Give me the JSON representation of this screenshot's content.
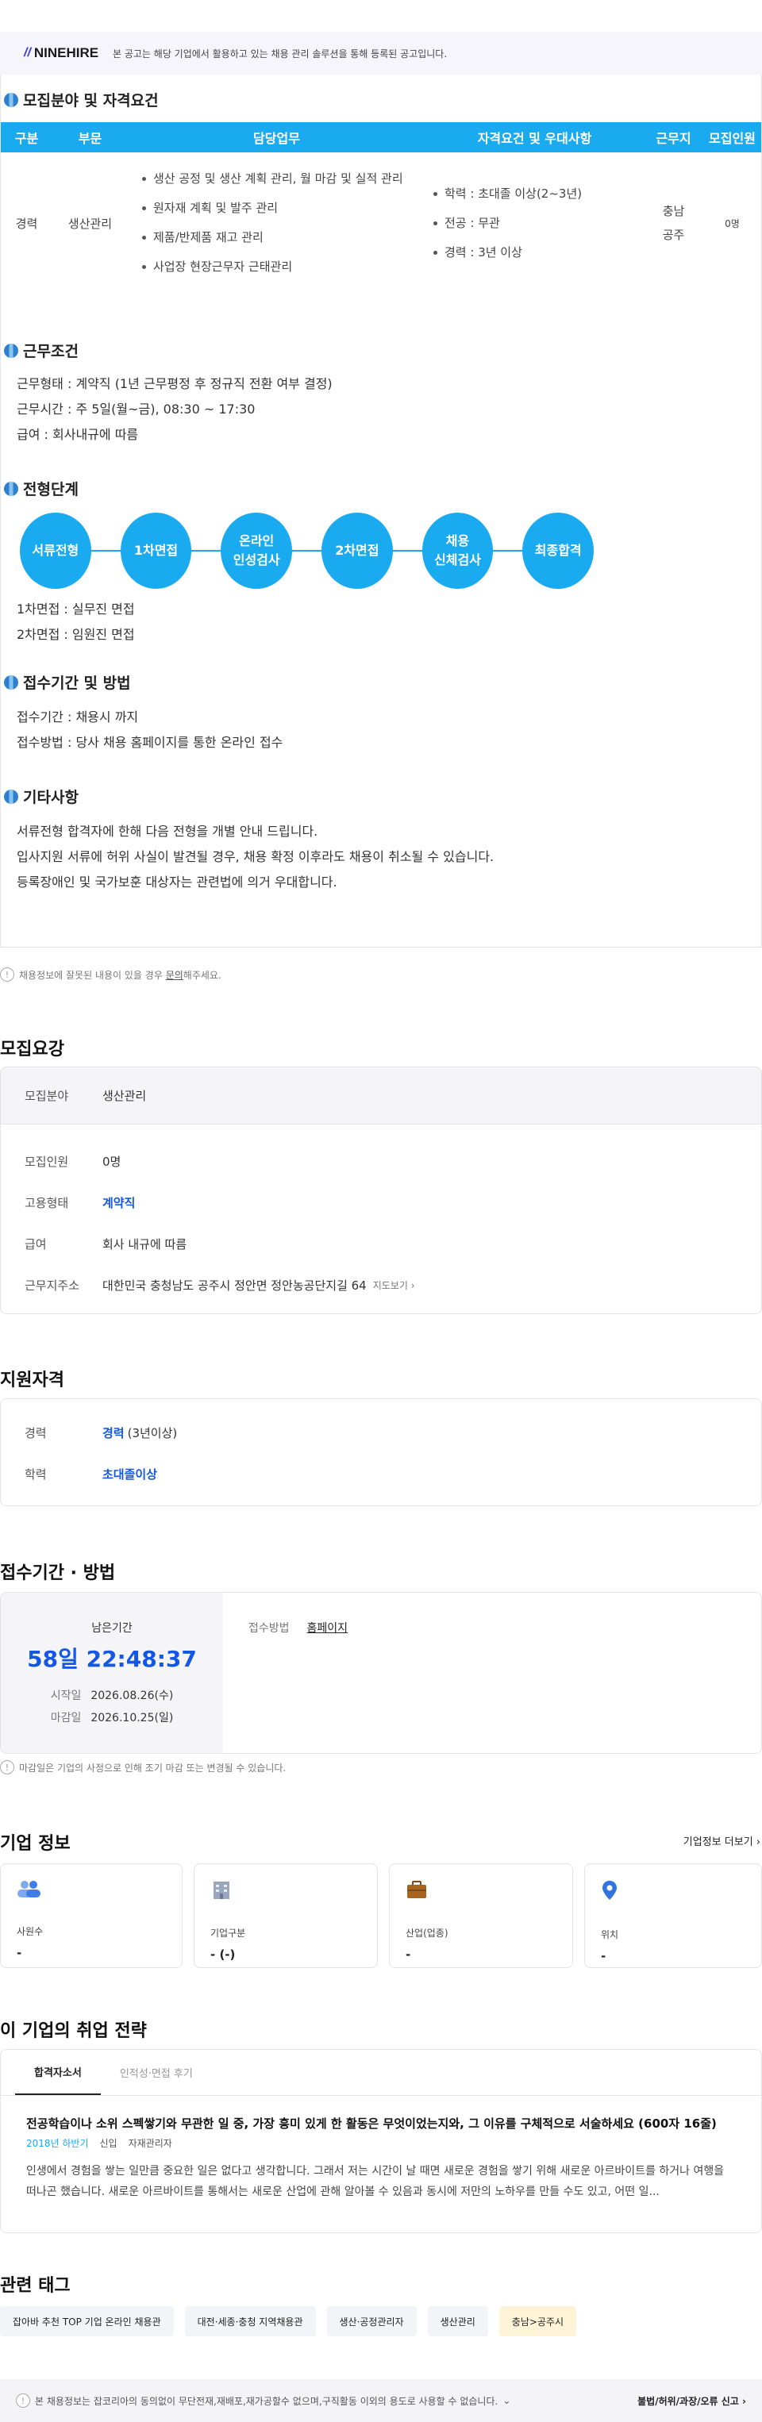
{
  "banner": {
    "logo_text": "NINEHIRE",
    "notice": "본 공고는 해당 기업에서 활용하고 있는 채용 관리 솔루션을 통해 등록된 공고입니다."
  },
  "recruit": {
    "title": "모집분야 및 자격요건",
    "headers": [
      "구분",
      "부문",
      "담당업무",
      "자격요건 및 우대사항",
      "근무지",
      "모집인원"
    ],
    "row": {
      "type": "경력",
      "dept": "생산관리",
      "duties": [
        "생산 공정 및 생산 계획 관리, 월 마감 및 실적 관리",
        "원자재 계획 및 발주 관리",
        "제품/반제품 재고 관리",
        "사업장 현장근무자 근태관리"
      ],
      "quals": [
        "학력 : 초대졸 이상(2~3년)",
        "전공 : 무관",
        "경력 : 3년 이상"
      ],
      "location": "충남\n공주",
      "headcount": "0명"
    }
  },
  "conditions": {
    "title": "근무조건",
    "lines": [
      "근무형태 : 계약직 (1년 근무평정 후 정규직 전환 여부 결정)",
      "근무시간 : 주 5일(월~금), 08:30 ~ 17:30",
      "급여 : 회사내규에 따름"
    ]
  },
  "process": {
    "title": "전형단계",
    "steps": [
      "서류전형",
      "1차면접",
      "온라인\n인성검사",
      "2차면접",
      "채용\n신체검사",
      "최종합격"
    ],
    "notes": [
      "1차면접 : 실무진 면접",
      "2차면접 : 임원진 면접"
    ]
  },
  "apply": {
    "title": "접수기간 및 방법",
    "lines": [
      "접수기간 : 채용시 까지",
      "접수방법 : 당사 채용 홈페이지를 통한 온라인 접수"
    ]
  },
  "etc": {
    "title": "기타사항",
    "lines": [
      "서류전형 합격자에 한해 다음 전형을 개별 안내 드립니다.",
      "입사지원 서류에 허위 사실이 발견될 경우, 채용 확정 이후라도 채용이 취소될 수 있습니다.",
      "등록장애인 및 국가보훈 대상자는 관련법에 의거 우대합니다."
    ]
  },
  "report_note": {
    "before": "채용정보에 잘못된 내용이 있을 경우 ",
    "link": "문의",
    "after": "해주세요."
  },
  "summary": {
    "title": "모집요강",
    "field_label": "모집분야",
    "field_value": "생산관리",
    "headcount_label": "모집인원",
    "headcount_value": "0명",
    "emp_label": "고용형태",
    "emp_value": "계약직",
    "salary_label": "급여",
    "salary_value": "회사 내규에 따름",
    "addr_label": "근무지주소",
    "addr_value": "대한민국 충청남도 공주시 정안면 정안농공단지길 64",
    "map_link": "지도보기"
  },
  "qualify": {
    "title": "지원자격",
    "career_label": "경력",
    "career_value": "경력",
    "career_extra": "(3년이상)",
    "edu_label": "학력",
    "edu_value": "초대졸이상"
  },
  "period": {
    "title": "접수기간 · 방법",
    "remain_label": "남은기간",
    "remain_value": "58일 22:48:37",
    "start_label": "시작일",
    "start_value": "2026.08.26(수)",
    "end_label": "마감일",
    "end_value": "2026.10.25(일)",
    "method_label": "접수방법",
    "method_value": "홈페이지",
    "note": "마감일은 기업의 사정으로 인해 조기 마감 또는 변경될 수 있습니다."
  },
  "company": {
    "title": "기업 정보",
    "more": "기업정보 더보기",
    "cards": [
      {
        "label": "사원수",
        "value": "-",
        "icon": "people-icon"
      },
      {
        "label": "기업구분",
        "value": "- (-)",
        "icon": "building-icon"
      },
      {
        "label": "산업(업종)",
        "value": "-",
        "icon": "briefcase-icon"
      },
      {
        "label": "위치",
        "value": "-",
        "icon": "location-pin-icon"
      }
    ]
  },
  "strategy": {
    "title": "이 기업의 취업 전략",
    "tabs": [
      "합격자소서",
      "인적성·면접 후기"
    ],
    "question": "전공학습이나 소위 스펙쌓기와 무관한 일 중, 가장 흥미 있게 한 활동은 무엇이었는지와, 그 이유를 구체적으로 서술하세요 (600자 16줄)",
    "meta": [
      "2018년 하반기",
      "신입",
      "자재관리자"
    ],
    "body": "인생에서 경험을 쌓는 일만큼 중요한 일은 없다고 생각합니다. 그래서 저는 시간이 날 때면 새로운 경험을 쌓기 위해 새로운 아르바이트를 하거나 여행을 떠나곤 했습니다. 새로운 아르바이트를 통해서는 새로운 산업에 관해 알아볼 수 있음과 동시에 저만의 노하우를 만들 수도 있고, 어떤 일..."
  },
  "tags": {
    "title": "관련 태그",
    "items": [
      "잡아바 추천 TOP 기업 온라인 채용관",
      "대전·세종·충청 지역채용관",
      "생산·공정관리자",
      "생산관리",
      "충남>공주시"
    ]
  },
  "footer": {
    "notice": "본 채용정보는 잡코리아의 동의없이 무단전재,재배포,재가공할수 없으며,구직활동 이외의 용도로 사용할 수 없습니다.",
    "report": "불법/허위/과장/오류 신고"
  },
  "colors": {
    "accent": "#1aaaf0",
    "link_blue": "#1457e6"
  }
}
